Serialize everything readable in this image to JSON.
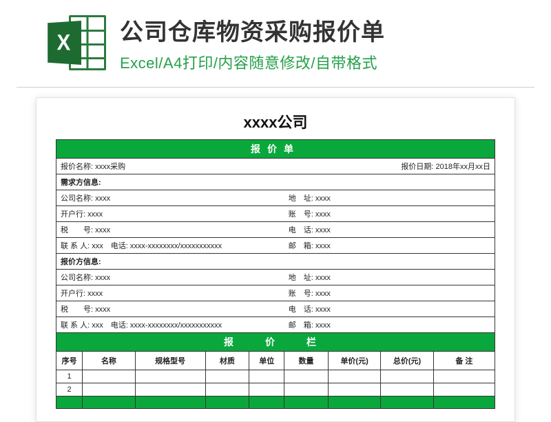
{
  "header": {
    "icon_name": "excel-icon",
    "icon_letter": "X",
    "main_title": "公司仓库物资采购报价单",
    "sub_title": "Excel/A4打印/内容随意修改/自带格式"
  },
  "doc": {
    "company_title": "xxxx公司",
    "sheet_title": "报价单",
    "quote_name_label": "报价名称:",
    "quote_name_value": "xxxx采购",
    "quote_date_label": "报价日期:",
    "quote_date_value": "2018年xx月xx日",
    "demand_section": "需求方信息:",
    "supply_section": "报价方信息:",
    "labels": {
      "company": "公司名称:",
      "bank": "开户行:",
      "tax": "税　　号:",
      "contact": "联 系 人:",
      "phone_inline": "电话:",
      "address": "地　址:",
      "account": "账　号:",
      "phone": "电　话:",
      "mail": "邮　箱:"
    },
    "demand": {
      "company": "xxxx",
      "bank": "xxxx",
      "tax": "xxxx",
      "contact": "xxx",
      "phone_detail": "xxxx-xxxxxxxx/xxxxxxxxxxx",
      "address": "xxxx",
      "account": "xxxx",
      "phone": "xxxx",
      "mail": "xxxx"
    },
    "supply": {
      "company": "xxxx",
      "bank": "xxxx",
      "tax": "xxxx",
      "contact": "xxx",
      "phone_detail": "xxxx-xxxxxxxx/xxxxxxxxxxx",
      "address": "xxxx",
      "account": "xxxx",
      "phone": "xxxx",
      "mail": "xxxx"
    },
    "price_section": "报　价　栏",
    "columns": {
      "no": "序号",
      "name": "名称",
      "spec": "规格型号",
      "material": "材质",
      "unit": "单位",
      "qty": "数量",
      "price": "单价(元)",
      "total": "总价(元)",
      "remark": "备 注"
    },
    "rows": [
      {
        "no": "1"
      },
      {
        "no": "2"
      }
    ]
  }
}
